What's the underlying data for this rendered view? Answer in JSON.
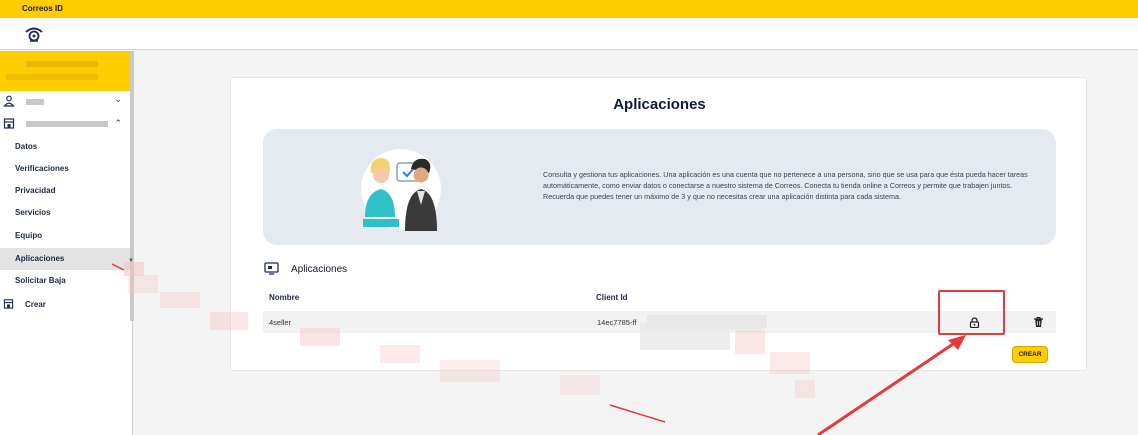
{
  "app": {
    "title": "Correos ID"
  },
  "sidebar": {
    "items": [
      {
        "label": "Datos",
        "active": false
      },
      {
        "label": "Verificaciones",
        "active": false
      },
      {
        "label": "Privacidad",
        "active": false
      },
      {
        "label": "Servicios",
        "active": false
      },
      {
        "label": "Equipo",
        "active": false
      },
      {
        "label": "Aplicaciones",
        "active": true
      },
      {
        "label": "Solicitar Baja",
        "active": false
      }
    ],
    "create_label": "Crear"
  },
  "main": {
    "title": "Aplicaciones",
    "info_text": "Consulta y gestiona tus aplicaciones. Una aplicación es una cuenta que no pertenece a una persona, sino que se usa para que ésta pueda hacer tareas automáticamente, como enviar datos o conectarse a nuestro sistema de Correos. Conecta tu tienda online a Correos y permite que trabajen juntos. Recuerda que puedes tener un máximo de 3 y que no necesitas crear una aplicación distinta para cada sistema.",
    "section_title": "Aplicaciones",
    "table": {
      "headers": [
        "Nombre",
        "Client Id"
      ],
      "rows": [
        {
          "name": "4seller",
          "client_id": "14ec7785-ff"
        }
      ]
    },
    "create_button": "CREAR"
  },
  "colors": {
    "brand_yellow": "#ffcd00",
    "annotation_red": "#e5393a",
    "info_box": "#e5e9f0"
  },
  "icons": [
    "correos-logo-icon",
    "user-icon",
    "store-icon",
    "chevron-down-icon",
    "chevron-up-icon",
    "applications-icon",
    "lock-icon",
    "trash-icon"
  ]
}
